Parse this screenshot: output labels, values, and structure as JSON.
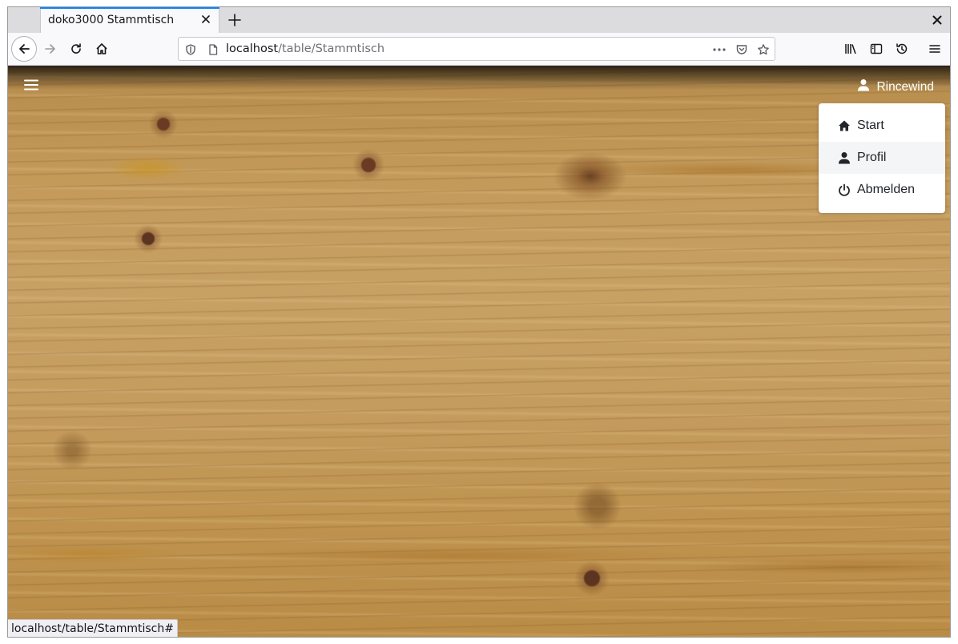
{
  "browser": {
    "tab_title": "doko3000 Stammtisch",
    "url_host": "localhost",
    "url_path": "/table/Stammtisch",
    "status_url": "localhost/table/Stammtisch#",
    "icons": [
      "back-arrow-icon",
      "forward-arrow-icon",
      "reload-icon",
      "home-icon",
      "shield-icon",
      "page-icon",
      "more-icon",
      "pocket-icon",
      "star-icon",
      "library-icon",
      "sidebar-icon",
      "history-icon",
      "menu-icon"
    ]
  },
  "app": {
    "user_name": "Rincewind",
    "menu": [
      {
        "label": "Start",
        "icon": "home-icon"
      },
      {
        "label": "Profil",
        "icon": "user-icon"
      },
      {
        "label": "Abmelden",
        "icon": "power-icon"
      }
    ],
    "background": "wood-texture",
    "accent_color": "#0a84ff"
  }
}
